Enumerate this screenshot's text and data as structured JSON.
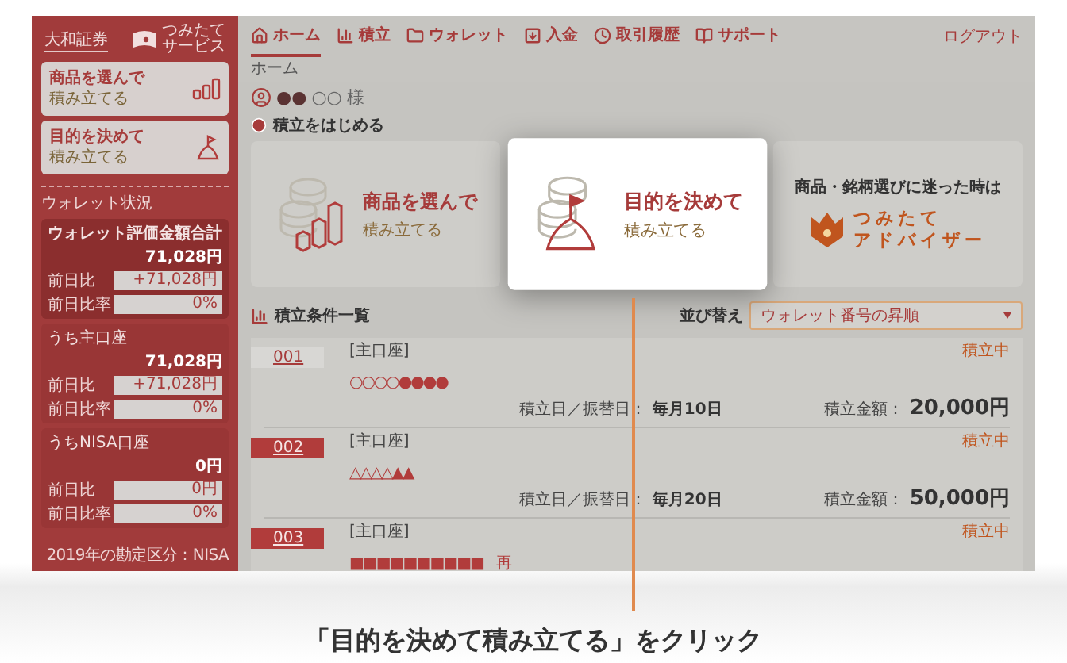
{
  "sidebar": {
    "brand": "大和証券",
    "service_lines": [
      "つみたて",
      "サービス"
    ],
    "shortcuts": [
      {
        "kind": "product",
        "title": "商品を選んで",
        "subtitle": "積み立てる"
      },
      {
        "kind": "goal",
        "title": "目的を決めて",
        "subtitle": "積み立てる"
      }
    ],
    "wallet_heading": "ウォレット状況",
    "wallet_groups": [
      {
        "title": "ウォレット評価金額合計",
        "amount": "71,028円",
        "emphasized": true,
        "rows": [
          {
            "label": "前日比",
            "value": "+71,028円"
          },
          {
            "label": "前日比率",
            "value": "0%"
          }
        ]
      },
      {
        "title": "うち主口座",
        "amount": "71,028円",
        "emphasized": false,
        "rows": [
          {
            "label": "前日比",
            "value": "+71,028円"
          },
          {
            "label": "前日比率",
            "value": "0%"
          }
        ]
      },
      {
        "title": "うちNISA口座",
        "amount": "0円",
        "emphasized": false,
        "rows": [
          {
            "label": "前日比",
            "value": "0円"
          },
          {
            "label": "前日比率",
            "value": "0%"
          }
        ]
      }
    ],
    "footer": "2019年の勘定区分：NISA"
  },
  "nav": {
    "tabs": [
      {
        "label": "ホーム",
        "selected": true
      },
      {
        "label": "積立",
        "selected": false
      },
      {
        "label": "ウォレット",
        "selected": false
      },
      {
        "label": "入金",
        "selected": false
      },
      {
        "label": "取引履歴",
        "selected": false
      },
      {
        "label": "サポート",
        "selected": false
      }
    ],
    "logout": "ログアウト"
  },
  "breadcrumb": "ホーム",
  "user": {
    "name_filled": "●●",
    "name_empty": "○○",
    "honorific": "様"
  },
  "start_section": {
    "heading": "積立をはじめる",
    "cards": [
      {
        "kind": "product",
        "title": "商品を選んで",
        "subtitle": "積み立てる",
        "highlighted": false
      },
      {
        "kind": "goal",
        "title": "目的を決めて",
        "subtitle": "積み立てる",
        "highlighted": true
      },
      {
        "kind": "advisor",
        "title": "商品・銘柄選びに迷った時は",
        "logo_lines": [
          "つみたて",
          "アドバイザー"
        ],
        "highlighted": false
      }
    ]
  },
  "plans": {
    "heading": "積立条件一覧",
    "sort_label": "並び替え",
    "sort_value": "ウォレット番号の昇順",
    "rows": [
      {
        "number": "001",
        "selected": true,
        "account": "[主口座]",
        "marks": "○○○○●●●●",
        "status": "積立中",
        "date_label": "積立日／振替日：",
        "date": "毎月10日",
        "amount_label": "積立金額：",
        "amount": "20,000円"
      },
      {
        "number": "002",
        "selected": false,
        "account": "[主口座]",
        "marks": "△△△△▲▲",
        "status": "積立中",
        "date_label": "積立日／振替日：",
        "date": "毎月20日",
        "amount_label": "積立金額：",
        "amount": "50,000円"
      },
      {
        "number": "003",
        "selected": false,
        "account": "[主口座]",
        "marks": "■■■■■■■■■■",
        "tag": "再",
        "status": "積立中"
      }
    ]
  },
  "caption": "「目的を決めて積み立てる」をクリック"
}
